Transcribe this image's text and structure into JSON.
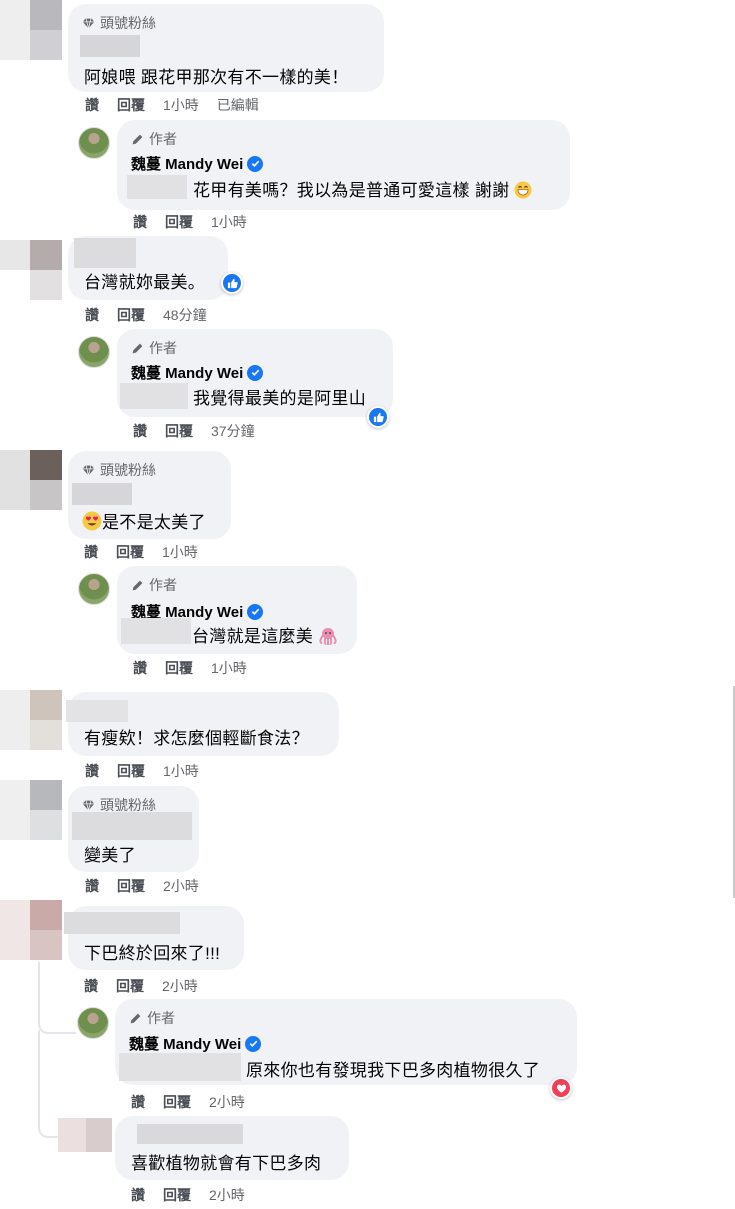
{
  "labels": {
    "fan_badge": "頭號粉絲",
    "author_badge": "作者",
    "like": "讚",
    "reply": "回覆",
    "edited": "已編輯"
  },
  "author": {
    "name": "魏蔓 Mandy Wei"
  },
  "comments": [
    {
      "text": "阿娘喂 跟花甲那次有不一樣的美！",
      "time": "1小時"
    },
    {
      "text": "花甲有美嗎？我以為是普通可愛這樣 謝謝",
      "time": "1小時"
    },
    {
      "text": "台灣就妳最美。",
      "time": "48分鐘"
    },
    {
      "text": "我覺得最美的是阿里山",
      "time": "37分鐘"
    },
    {
      "text": "是不是太美了",
      "time": "1小時"
    },
    {
      "text": "台灣就是這麼美",
      "time": "1小時"
    },
    {
      "text": "有瘦欸！求怎麼個輕斷食法？",
      "time": "1小時"
    },
    {
      "text": "變美了",
      "time": "2小時"
    },
    {
      "text": "下巴終於回來了!!!",
      "time": "2小時"
    },
    {
      "text": "原來你也有發現我下巴多肉植物很久了",
      "time": "2小時"
    },
    {
      "text": "喜歡植物就會有下巴多肉",
      "time": "2小時"
    }
  ],
  "colors": {
    "bubble": "#f0f2f5",
    "meta_text": "#65676b",
    "like_blue": "#1877f2",
    "love_red": "#f33e58"
  },
  "icons": [
    "diamond-icon",
    "pencil-icon",
    "verified-icon",
    "like-reaction-icon",
    "love-reaction-icon",
    "grin-emoji-icon",
    "heart-eyes-emoji-icon",
    "octopus-emoji-icon"
  ]
}
